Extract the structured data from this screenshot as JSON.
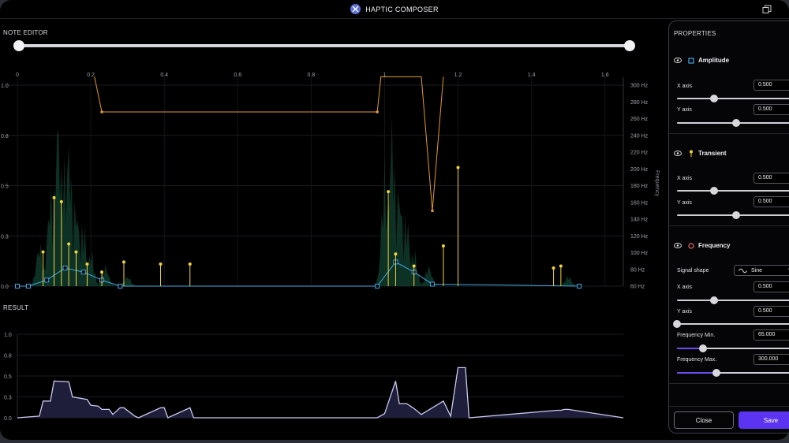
{
  "app": {
    "title": "HAPTIC COMPOSER"
  },
  "note_editor": {
    "label": "NOTE EDITOR",
    "x_ticks": [
      "0",
      "0.2",
      "0.4",
      "0.6",
      "0.8",
      "1",
      "1.2",
      "1.4",
      "1.6"
    ],
    "y_ticks": [
      "0.0",
      "0.3",
      "0.5",
      "0.8",
      "1.0"
    ],
    "freq_ticks": [
      "60 Hz",
      "80 Hz",
      "100 Hz",
      "120 Hz",
      "140 Hz",
      "160 Hz",
      "180 Hz",
      "200 Hz",
      "220 Hz",
      "240 Hz",
      "260 Hz",
      "280 Hz",
      "300 Hz"
    ],
    "freq_axis_label": "Frequency"
  },
  "result": {
    "label": "RESULT",
    "y_ticks": [
      "0.0",
      "0.3",
      "0.5",
      "0.8",
      "1.0"
    ]
  },
  "properties": {
    "title": "PROPERTIES",
    "amplitude": {
      "label": "Amplitude",
      "x_label": "X axis",
      "x_value": "0.500",
      "y_label": "Y axis",
      "y_value": "0.500",
      "x_slider": 0.31,
      "y_slider": 0.5
    },
    "transient": {
      "label": "Transient",
      "x_label": "X axis",
      "x_value": "0.500",
      "y_label": "Y axis",
      "y_value": "0.500",
      "x_slider": 0.31,
      "y_slider": 0.5
    },
    "frequency": {
      "label": "Frequency",
      "signal_shape_label": "Signal shape",
      "signal_shape_value": "Sine",
      "x_label": "X axis",
      "x_value": "0.500",
      "x_slider": 0.31,
      "y_label": "Y axis",
      "y_value": "0.500",
      "y_slider": 0.0,
      "fmin_label": "Frequency Min.",
      "fmin_value": "65.000",
      "fmin_slider": 0.22,
      "fmax_label": "Frequency Max.",
      "fmax_value": "300.000",
      "fmax_slider": 0.33
    },
    "close_label": "Close",
    "save_label": "Save"
  },
  "colors": {
    "accent": "#5a34f0",
    "amplitude": "#3fa8e6",
    "transient": "#f2d33a",
    "frequency": "#e59a2a",
    "result_line": "#c9c9ef"
  },
  "chart_data": [
    {
      "type": "line",
      "title": "NOTE EDITOR",
      "xlim": [
        0,
        1.65
      ],
      "ylim": [
        0,
        1.0
      ],
      "series": [
        {
          "name": "Amplitude",
          "x": [
            0,
            0.03,
            0.08,
            0.13,
            0.18,
            0.23,
            0.28,
            0.98,
            1.03,
            1.08,
            1.13,
            1.53
          ],
          "y": [
            0,
            0,
            0.03,
            0.09,
            0.07,
            0.03,
            0,
            0,
            0.12,
            0.07,
            0.01,
            0.0
          ]
        },
        {
          "name": "Transient",
          "x": [
            0.07,
            0.1,
            0.12,
            0.14,
            0.16,
            0.19,
            0.23,
            0.29,
            0.39,
            0.47,
            1.01,
            1.03,
            1.08,
            1.16,
            1.2,
            1.46,
            1.48
          ],
          "y": [
            0.17,
            0.44,
            0.42,
            0.21,
            0.17,
            0.11,
            0.07,
            0.12,
            0.11,
            0.11,
            0.47,
            0.16,
            0.1,
            0.2,
            0.59,
            0.09,
            0.1
          ]
        },
        {
          "name": "Frequency",
          "x": [
            0.21,
            0.23,
            0.98,
            0.99,
            1.1,
            1.13,
            1.16
          ],
          "y": [
            310,
            268,
            268,
            310,
            310,
            150,
            310
          ]
        }
      ]
    },
    {
      "type": "area",
      "title": "RESULT",
      "xlim": [
        0,
        1.65
      ],
      "ylim": [
        0,
        1.0
      ],
      "series": [
        {
          "x": [
            0,
            0.06,
            0.07,
            0.09,
            0.1,
            0.14,
            0.15,
            0.19,
            0.2,
            0.22,
            0.23,
            0.25,
            0.26,
            0.28,
            0.29,
            0.32,
            0.33,
            0.39,
            0.4,
            0.41,
            0.47,
            0.48,
            0.5,
            0.98,
            1.0,
            1.03,
            1.04,
            1.06,
            1.08,
            1.1,
            1.16,
            1.18,
            1.2,
            1.22,
            1.23,
            1.47,
            1.48,
            1.49,
            1.5,
            1.65
          ],
          "y": [
            0,
            0.02,
            0.2,
            0.2,
            0.44,
            0.43,
            0.25,
            0.22,
            0.15,
            0.14,
            0.1,
            0.1,
            0.04,
            0.12,
            0.12,
            0.02,
            0.0,
            0.12,
            0.12,
            0.0,
            0.12,
            0.0,
            0.0,
            0.0,
            0.05,
            0.44,
            0.17,
            0.17,
            0.11,
            0.04,
            0.2,
            0.02,
            0.6,
            0.6,
            0.0,
            0.09,
            0.09,
            0.1,
            0.1,
            0.0
          ]
        }
      ]
    }
  ]
}
